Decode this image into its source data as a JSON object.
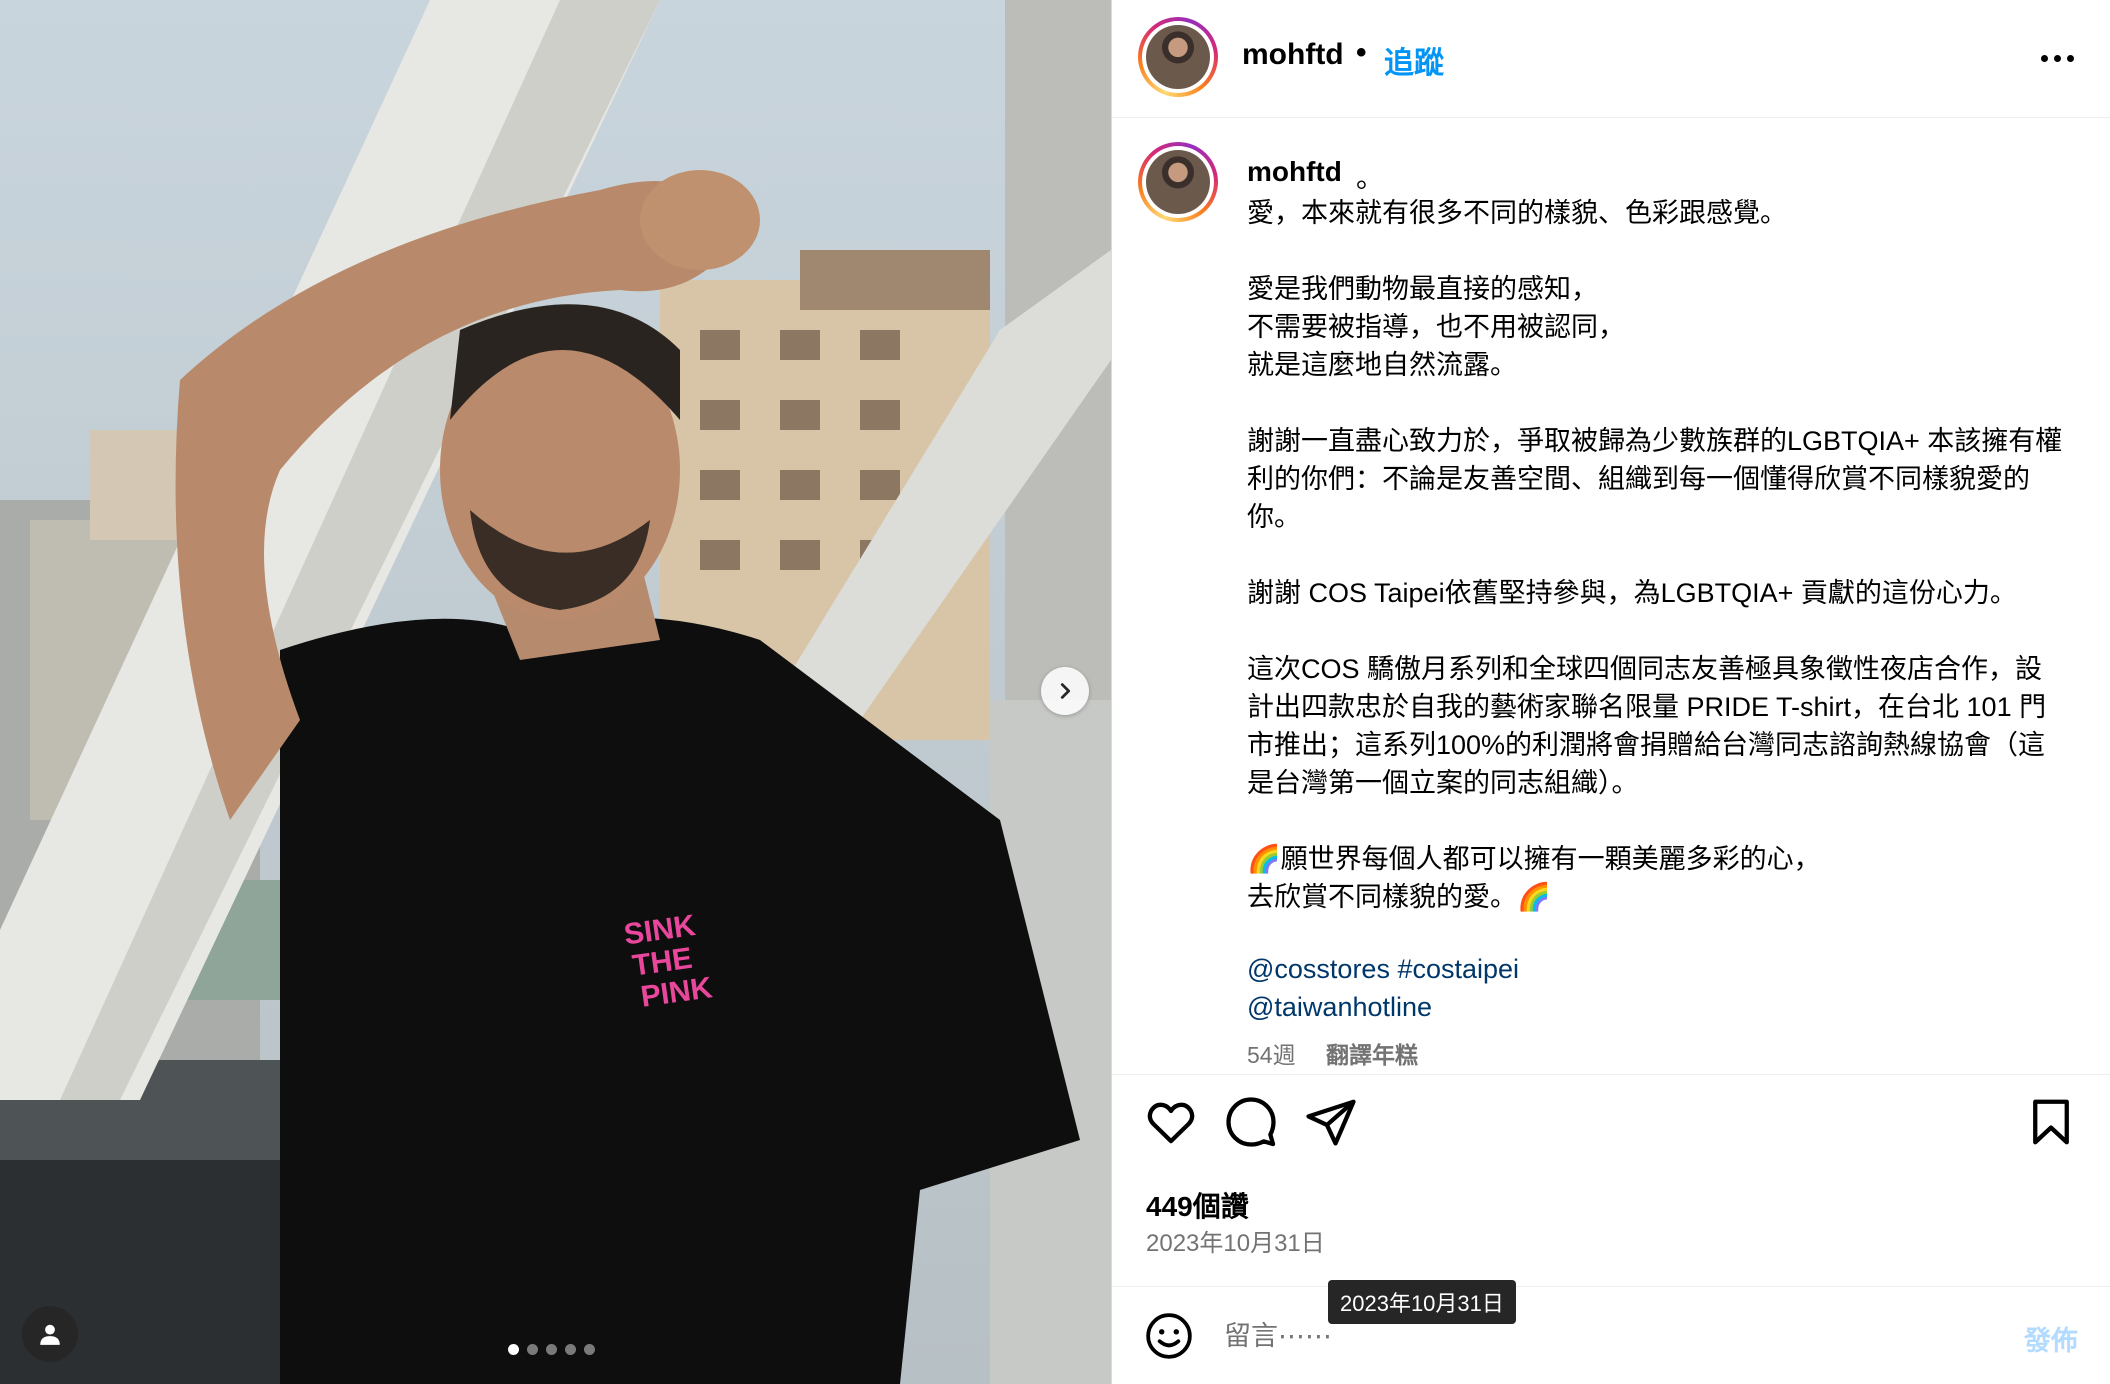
{
  "header": {
    "username": "mohftd",
    "separator": "•",
    "follow_label": "追蹤",
    "more_icon": "more-horizontal-icon"
  },
  "caption": {
    "username": "mohftd",
    "dot": "。",
    "text": "愛，本來就有很多不同的樣貌、色彩跟感覺。\n\n愛是我們動物最直接的感知，\n不需要被指導，也不用被認同，\n就是這麼地自然流露。\n\n謝謝一直盡心致力於，爭取被歸為少數族群的LGBTQIA+ 本該擁有權利的你們：不論是友善空間、組織到每一個懂得欣賞不同樣貌愛的你。\n\n謝謝 COS Taipei依舊堅持參與，為LGBTQIA+ 貢獻的這份心力。\n\n這次COS 驕傲月系列和全球四個同志友善極具象徵性夜店合作，設計出四款忠於自我的藝術家聯名限量 PRIDE T-shirt，在台北 101 門市推出；這系列100%的利潤將會捐贈給台灣同志諮詢熱線協會（這是台灣第一個立案的同志組織）。\n\n🌈願世界每個人都可以擁有一顆美麗多彩的心，\n去欣賞不同樣貌的愛。🌈",
    "tag_1": "@cosstores",
    "tag_2": "#costaipei",
    "tag_3": "@taiwanhotline",
    "age": "54週",
    "translate_label": "翻譯年糕"
  },
  "media": {
    "shirt_text_1": "SINK",
    "shirt_text_2": "THE",
    "shirt_text_3": "PINK",
    "carousel_total": 5,
    "carousel_active": 1
  },
  "actions": {
    "likes": "449個讚",
    "date": "2023年10月31日",
    "tooltip": "2023年10月31日"
  },
  "comment": {
    "placeholder": "留言⋯⋯",
    "post_label": "發佈"
  },
  "colors": {
    "follow_blue": "#0095f6",
    "link_blue": "#00376b",
    "muted_gray": "#737373",
    "post_disabled": "#b3dbff",
    "shirt_pink": "#e8479b"
  }
}
